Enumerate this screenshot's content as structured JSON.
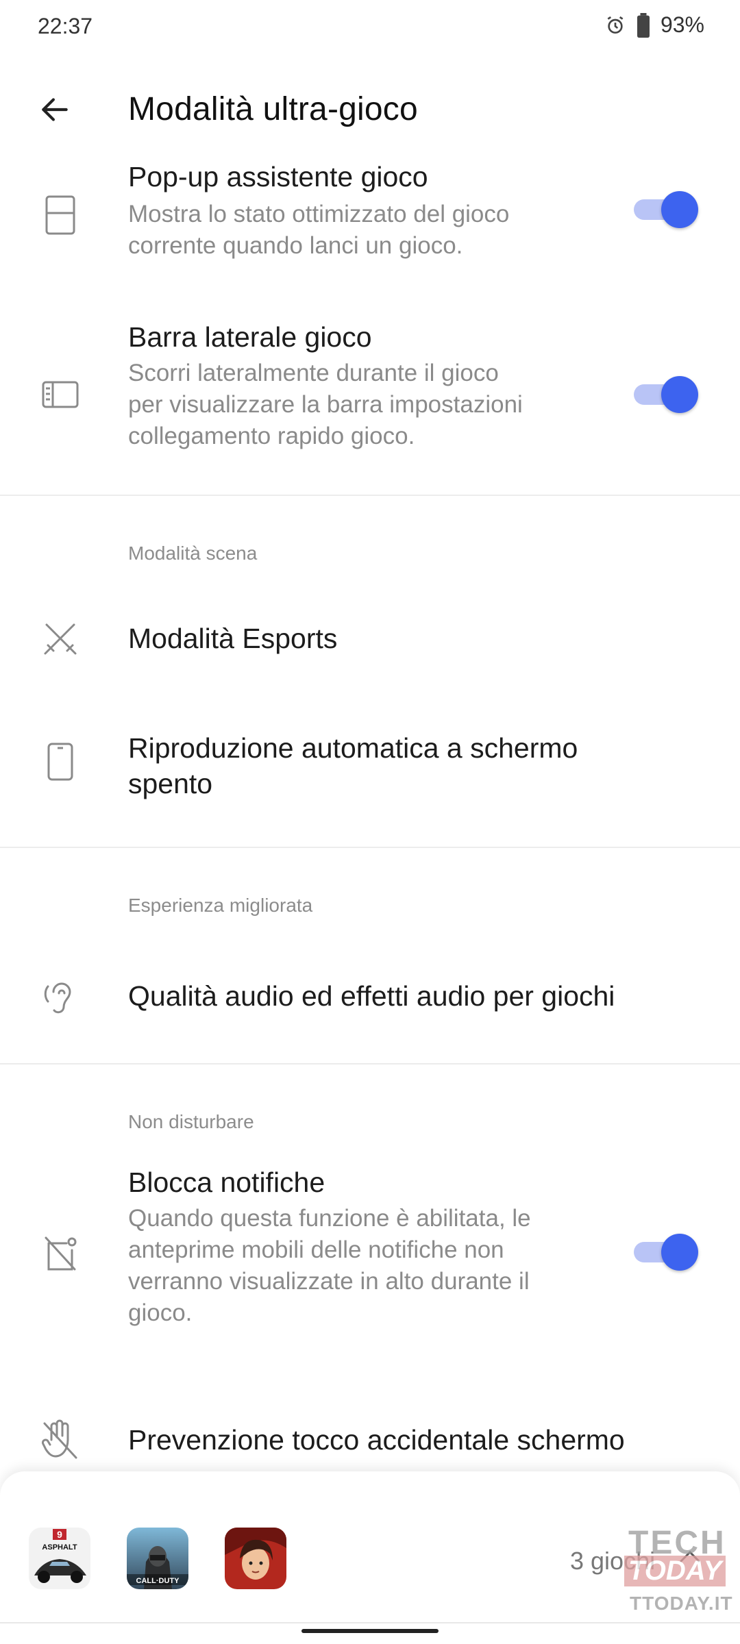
{
  "status_bar": {
    "time": "22:37",
    "battery": "93%"
  },
  "app_bar": {
    "title": "Modalità ultra-gioco"
  },
  "settings": {
    "popup_assistant": {
      "title": "Pop-up assistente gioco",
      "subtitle_lines": [
        "Mostra lo stato ottimizzato del gioco",
        "corrente quando lanci un gioco."
      ],
      "enabled": true
    },
    "side_bar": {
      "title": "Barra laterale gioco",
      "subtitle_lines": [
        "Scorri lateralmente durante il gioco",
        "per visualizzare la barra impostazioni",
        "collegamento rapido gioco."
      ],
      "enabled": true
    },
    "section_scene": "Modalità scena",
    "esports": {
      "title": "Modalità Esports"
    },
    "autoplay": {
      "title_lines": [
        "Riproduzione automatica a schermo",
        "spento"
      ]
    },
    "section_experience": "Esperienza migliorata",
    "audio": {
      "title": "Qualità audio ed effetti audio per giochi"
    },
    "section_dnd": "Non disturbare",
    "block_notifications": {
      "title": "Blocca notifiche",
      "subtitle_lines": [
        "Quando questa funzione è abilitata, le",
        "anteprime mobili delle notifiche non",
        "verranno visualizzate in alto durante il",
        "gioco."
      ],
      "enabled": true
    },
    "touch_prevention": {
      "title": "Prevenzione tocco accidentale schermo"
    }
  },
  "games_sheet": {
    "games": [
      {
        "name": "Asphalt 9",
        "label_top": "9",
        "label": "ASPHALT"
      },
      {
        "name": "Call of Duty",
        "label": "CALL·DUTY"
      },
      {
        "name": "Free Fire"
      }
    ],
    "count_label": "3 giochi"
  },
  "watermark": {
    "line1": "TECH",
    "line2": "TODAY",
    "line3": "TTODAY.IT"
  },
  "colors": {
    "accent": "#3d63ef",
    "accent_track": "#b9c4f6",
    "subtitle": "#8a8a8a",
    "section": "#8c8c8c"
  }
}
